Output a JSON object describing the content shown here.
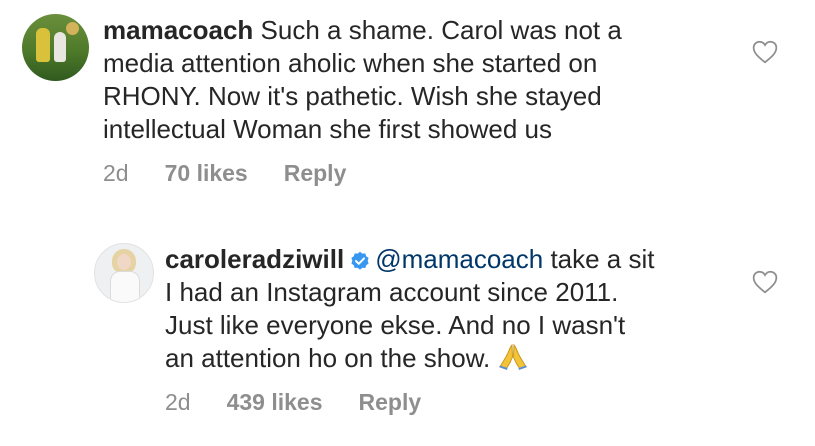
{
  "comments": [
    {
      "username": "mamacoach",
      "text_lines": [
        "Such a shame. Carol was not a",
        "media attention aholic when she started on",
        "RHONY. Now it's pathetic.  Wish she stayed",
        "intellectual Woman she first showed us"
      ],
      "time": "2d",
      "likes": "70 likes",
      "reply_label": "Reply",
      "avatar_icon": "avatar-photo-icon",
      "like_icon": "heart-outline-icon"
    },
    {
      "username": "caroleradziwill",
      "verified": true,
      "mention": "@mamacoach",
      "text_lines": [
        "take a sit",
        "I had an Instagram account since 2011.",
        "Just like everyone ekse. And no I wasn't",
        "an attention ho on the show."
      ],
      "emoji": "folded-hands-icon",
      "time": "2d",
      "likes": "439 likes",
      "reply_label": "Reply",
      "avatar_icon": "avatar-photo-icon",
      "like_icon": "heart-outline-icon"
    }
  ],
  "colors": {
    "text": "#262626",
    "meta": "#8e8e8e",
    "mention": "#00376b",
    "verified": "#3897f0"
  }
}
